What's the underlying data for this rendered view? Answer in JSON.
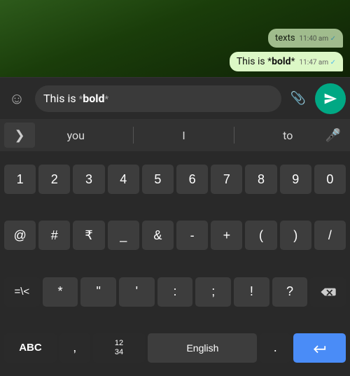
{
  "chat": {
    "bubble1": {
      "text": "texts",
      "time": "11:40 am",
      "check": "✓"
    },
    "bubble2": {
      "prefix": "This is ",
      "bold_marker_open": "*",
      "bold_text": "bold",
      "bold_marker_close": "*",
      "time": "11:47 am",
      "check": "✓"
    }
  },
  "input_bar": {
    "emoji_icon": "☺",
    "input_prefix": "This is ",
    "input_asterisk_open": "*",
    "input_bold": "bold",
    "input_asterisk_close": "*",
    "attach_icon": "📎",
    "send_icon": "send"
  },
  "keyboard": {
    "suggestions": {
      "expand_icon": ">",
      "items": [
        "you",
        "I",
        "to"
      ],
      "mic_icon": "🎤"
    },
    "row_numbers": [
      "1",
      "2",
      "3",
      "4",
      "5",
      "6",
      "7",
      "8",
      "9",
      "0"
    ],
    "row_symbols1": [
      "@",
      "#",
      "₹",
      "_",
      "&",
      "-",
      "+",
      "(",
      ")",
      "/"
    ],
    "row_symbols2": [
      "=\\<",
      "*",
      "\"",
      "'",
      ":",
      ";",
      "!",
      "?",
      "⌫"
    ],
    "row_bottom": {
      "abc_label": "ABC",
      "comma_label": ",",
      "numbers_grid_label": "12\n34",
      "language_label": "English",
      "period_label": ".",
      "enter_icon": "↵"
    }
  }
}
